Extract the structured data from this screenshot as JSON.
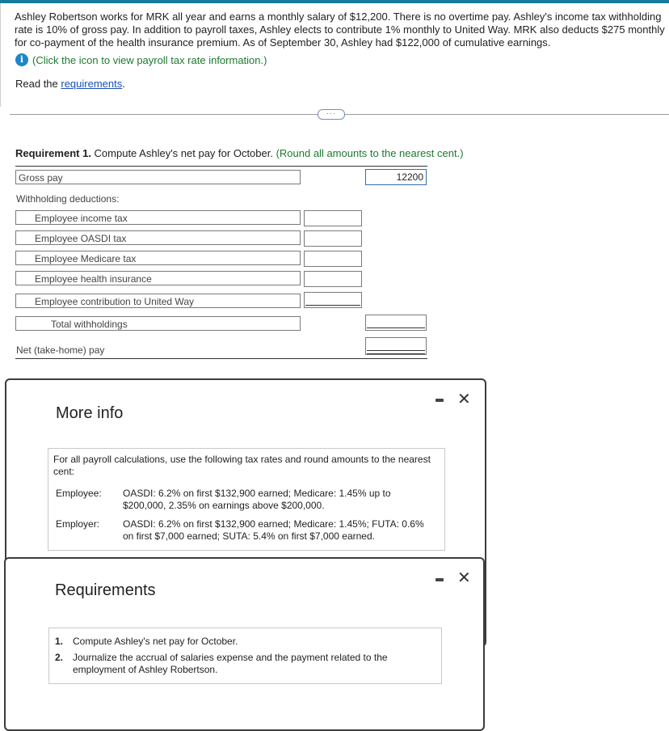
{
  "problem": {
    "text": "Ashley Robertson works for MRK all year and earns a monthly salary of $12,200. There is no overtime pay. Ashley's income tax withholding rate is 10% of gross pay. In addition to payroll taxes, Ashley elects to contribute 1% monthly to United Way. MRK also deducts $275 monthly for co-payment of the health insurance premium. As of September 30, Ashley had $122,000 of cumulative earnings.",
    "info_link": "(Click the icon to view payroll tax rate information.)",
    "read_prefix": "Read the ",
    "read_link": "requirements",
    "read_suffix": "."
  },
  "expand_button": "···",
  "requirement1": {
    "label": "Requirement 1.",
    "text": " Compute Ashley's net pay for October. ",
    "note": "(Round all amounts to the nearest cent.)"
  },
  "table": {
    "gross_pay_label": "Gross pay",
    "gross_pay_value": "12200",
    "withholding_label": "Withholding deductions:",
    "deductions": [
      {
        "label": "Employee income tax",
        "value": ""
      },
      {
        "label": "Employee OASDI tax",
        "value": ""
      },
      {
        "label": "Employee Medicare tax",
        "value": ""
      },
      {
        "label": "Employee health insurance",
        "value": ""
      },
      {
        "label": "Employee contribution to United Way",
        "value": ""
      }
    ],
    "total_label": "Total withholdings",
    "total_value": "",
    "net_label": "Net (take-home) pay",
    "net_value": ""
  },
  "more_info": {
    "title": "More info",
    "intro": "For all payroll calculations, use the following tax rates and round amounts to the nearest cent:",
    "employee_label": "Employee:",
    "employee_rates": "OASDI: 6.2% on first $132,900 earned; Medicare: 1.45% up to $200,000, 2.35% on earnings above $200,000.",
    "employer_label": "Employer:",
    "employer_rates": "OASDI: 6.2% on first $132,900 earned; Medicare: 1.45%; FUTA: 0.6% on first $7,000 earned; SUTA: 5.4% on first $7,000 earned."
  },
  "requirements_modal": {
    "title": "Requirements",
    "items": [
      {
        "num": "1.",
        "text": "Compute Ashley's net pay for October."
      },
      {
        "num": "2.",
        "text": "Journalize the accrual of salaries expense and the payment related to the employment of Ashley Robertson."
      }
    ]
  },
  "colors": {
    "accent": "#137c9b",
    "instruction_green": "#1e7a2e",
    "link_blue": "#1a4fb5",
    "info_icon": "#1f86c8"
  },
  "icons": {
    "info": "info-icon",
    "minimize": "minimize-icon",
    "close": "close-icon"
  }
}
